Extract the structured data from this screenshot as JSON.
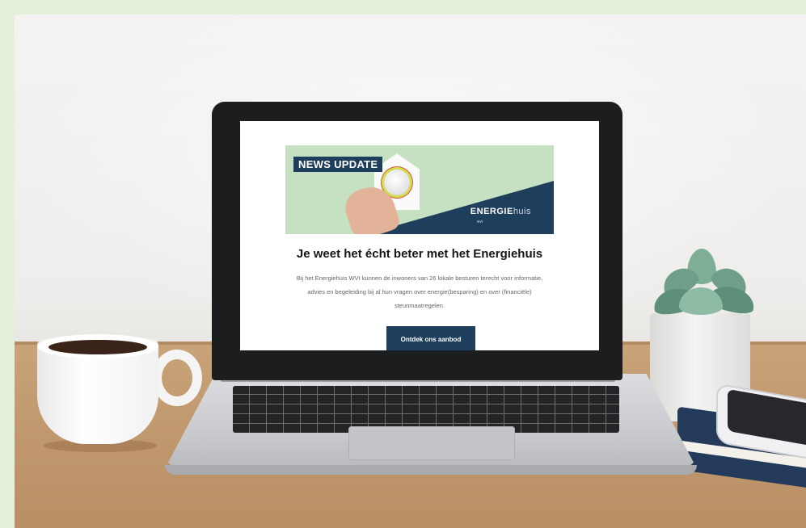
{
  "newsletter": {
    "banner_tag": "NEWS UPDATE",
    "brand_bold": "ENERGIE",
    "brand_light": "huis",
    "brand_sub": "wvi",
    "headline": "Je weet het écht beter met het Energiehuis",
    "body": "Bij het Energiehuis WVI kunnen de inwoners van 26 lokale besturen terecht voor informatie, advies en begeleiding bij al hun vragen over energie(besparing) en over (financiële) steunmaatregelen.",
    "cta_label": "Ontdek ons aanbod"
  },
  "colors": {
    "frame": "#e4efdc",
    "brand_navy": "#1e3f5c",
    "banner_green": "#c6e0c2"
  },
  "icons": [
    "thermostat-knob-icon",
    "house-icon"
  ]
}
